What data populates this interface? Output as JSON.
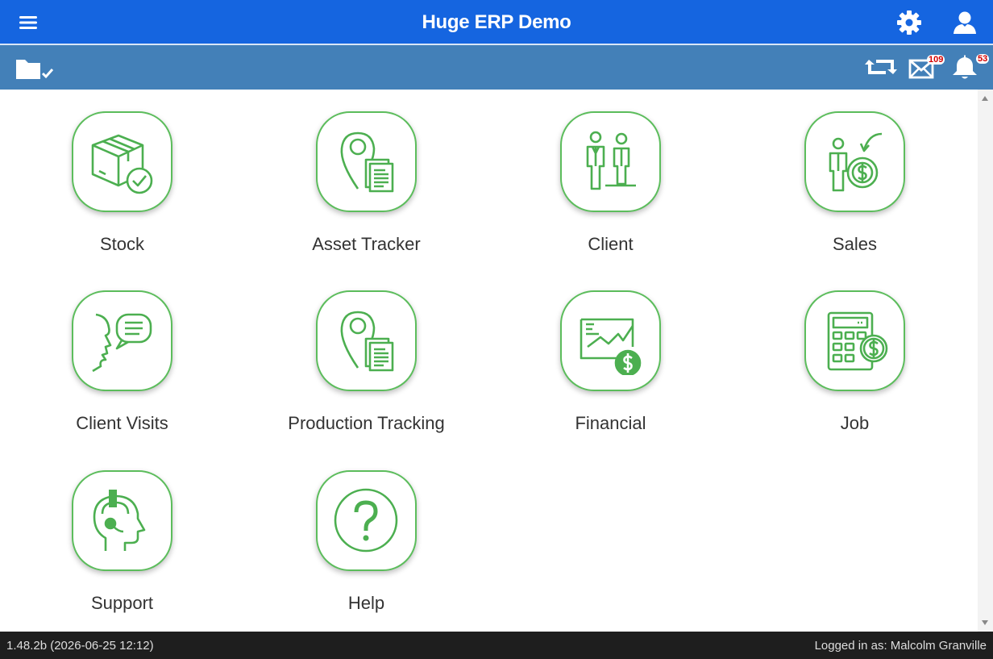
{
  "header": {
    "title": "Huge ERP Demo",
    "menu_icon": "hamburger-menu-icon",
    "settings_icon": "gear-icon",
    "user_icon": "user-icon",
    "brand_color": "#1565e0"
  },
  "toolbar": {
    "folder_icon": "folder-check-icon",
    "sync_icon": "sync-icon",
    "mail_icon": "mail-icon",
    "mail_count": "109",
    "bell_icon": "bell-icon",
    "notification_count": "53",
    "bar_color": "#4380b8"
  },
  "tiles": [
    {
      "label": "Stock",
      "icon": "box-check-icon"
    },
    {
      "label": "Asset Tracker",
      "icon": "location-document-icon"
    },
    {
      "label": "Client",
      "icon": "people-icon"
    },
    {
      "label": "Sales",
      "icon": "person-dollar-icon"
    },
    {
      "label": "Client Visits",
      "icon": "face-speech-icon"
    },
    {
      "label": "Production Tracking",
      "icon": "location-document-icon"
    },
    {
      "label": "Financial",
      "icon": "chart-dollar-icon"
    },
    {
      "label": "Job",
      "icon": "calculator-dollar-icon"
    },
    {
      "label": "Support",
      "icon": "headset-head-icon"
    },
    {
      "label": "Help",
      "icon": "question-icon"
    }
  ],
  "accent_color": "#4caf50",
  "footer": {
    "version": "1.48.2b (2026-06-25 12:12)",
    "login": "Logged in as: Malcolm Granville"
  }
}
